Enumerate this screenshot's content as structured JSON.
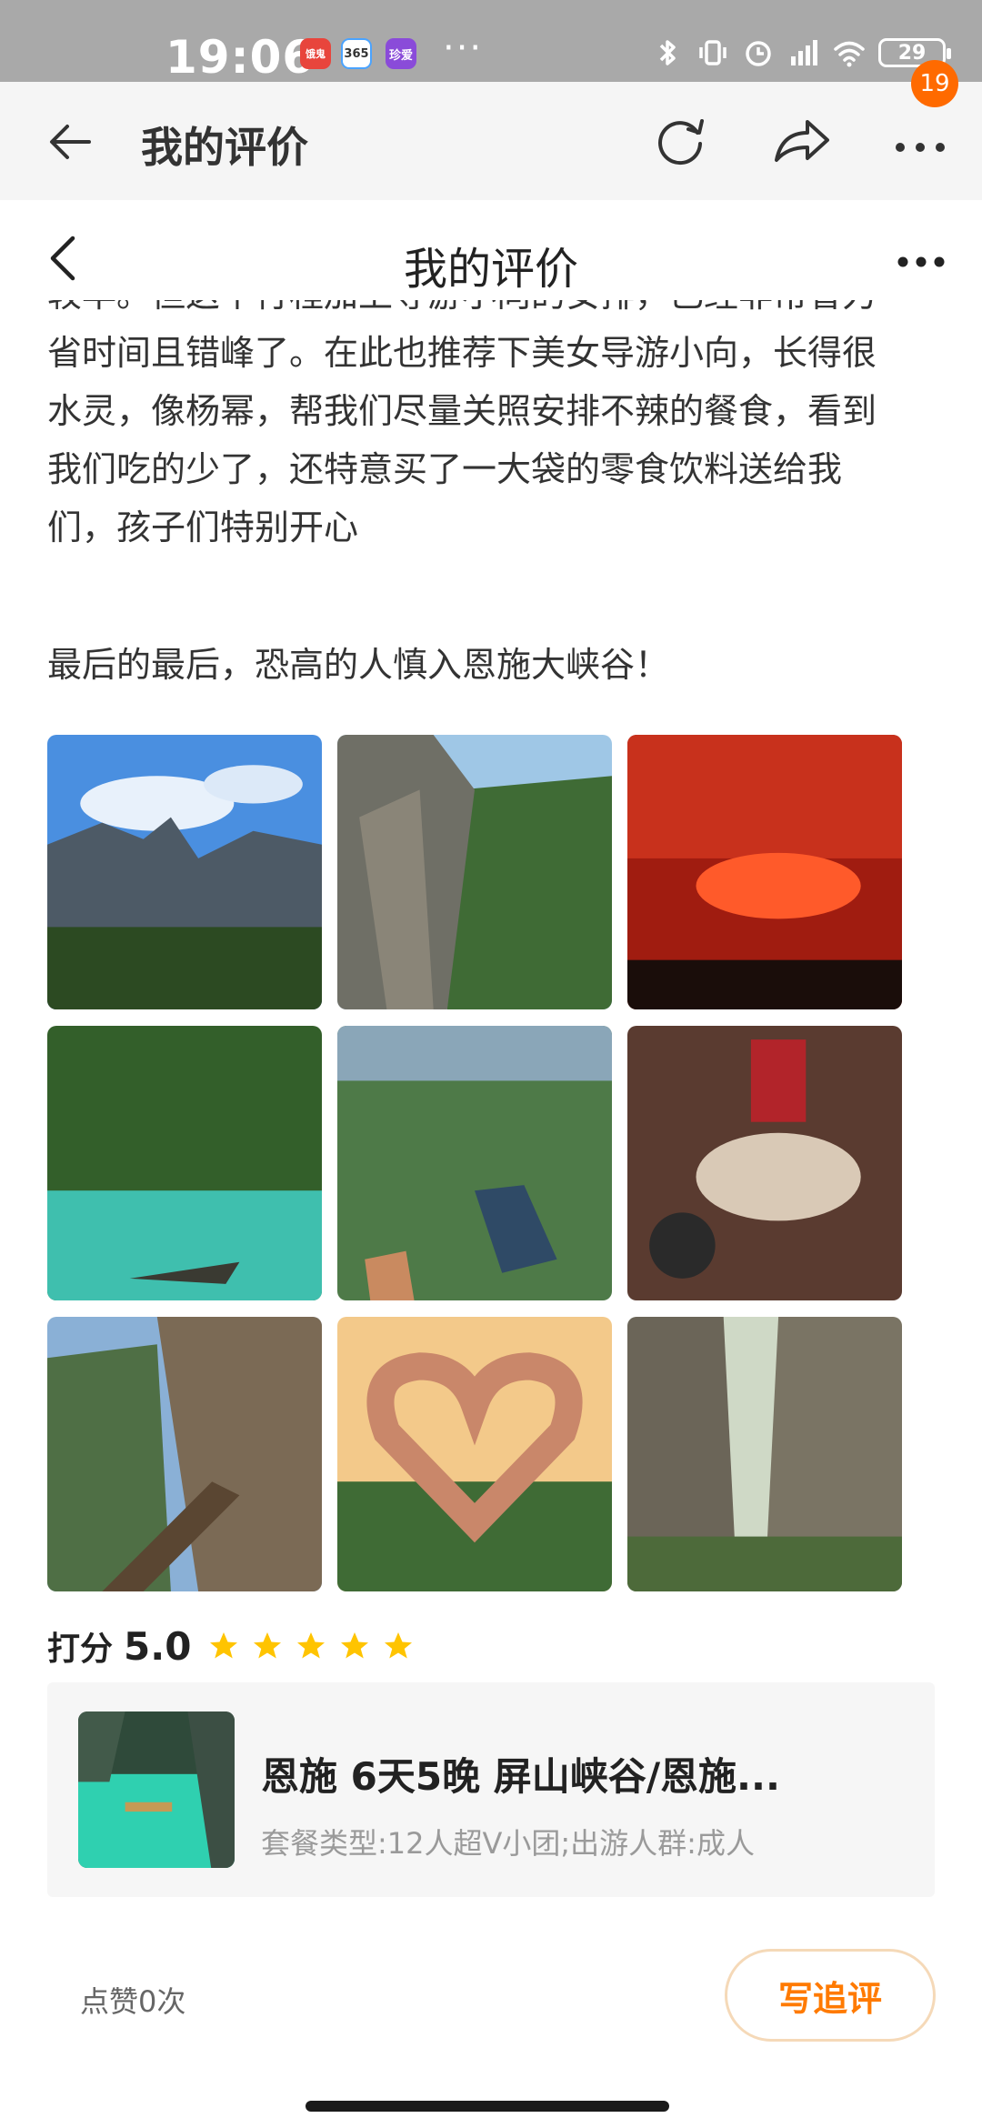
{
  "status_bar": {
    "time": "19:06",
    "app_icons": [
      "饿鬼",
      "365",
      "珍爱"
    ],
    "more": "···",
    "battery": "29"
  },
  "outer_bar": {
    "title": "我的评价",
    "notification_count": "19"
  },
  "inner_bar": {
    "title": "我的评价"
  },
  "review": {
    "lines": [
      "较早。但这个行程加上导游小向的安排，已经非常省力",
      "省时间且错峰了。在此也推荐下美女导游小向，长得很",
      "水灵，像杨幂，帮我们尽量关照安排不辣的餐食，看到",
      "我们吃的少了，还特意买了一大袋的零食饮料送给我",
      "们，孩子们特别开心"
    ],
    "final_line": "最后的最后，恐高的人慎入恩施大峡谷！"
  },
  "photos": [
    "cliff-sky-photo",
    "plank-road-photo",
    "red-stage-show-photo",
    "river-boat-photo",
    "glass-walkway-photo",
    "banquet-dinner-photo",
    "cliff-walkway-photo",
    "heart-hands-sunset-photo",
    "canyon-photo"
  ],
  "rating": {
    "label": "打分",
    "score": "5.0",
    "stars": 5,
    "star_color": "#ffc400"
  },
  "product": {
    "title": "恩施 6天5晚 屏山峡谷/恩施...",
    "subtitle": "套餐类型:12人超V小团;出游人群:成人"
  },
  "footer": {
    "likes": "点赞0次",
    "write_button": "写追评"
  },
  "colors": {
    "accent": "#ff7a00",
    "badge": "#ff6a00"
  }
}
